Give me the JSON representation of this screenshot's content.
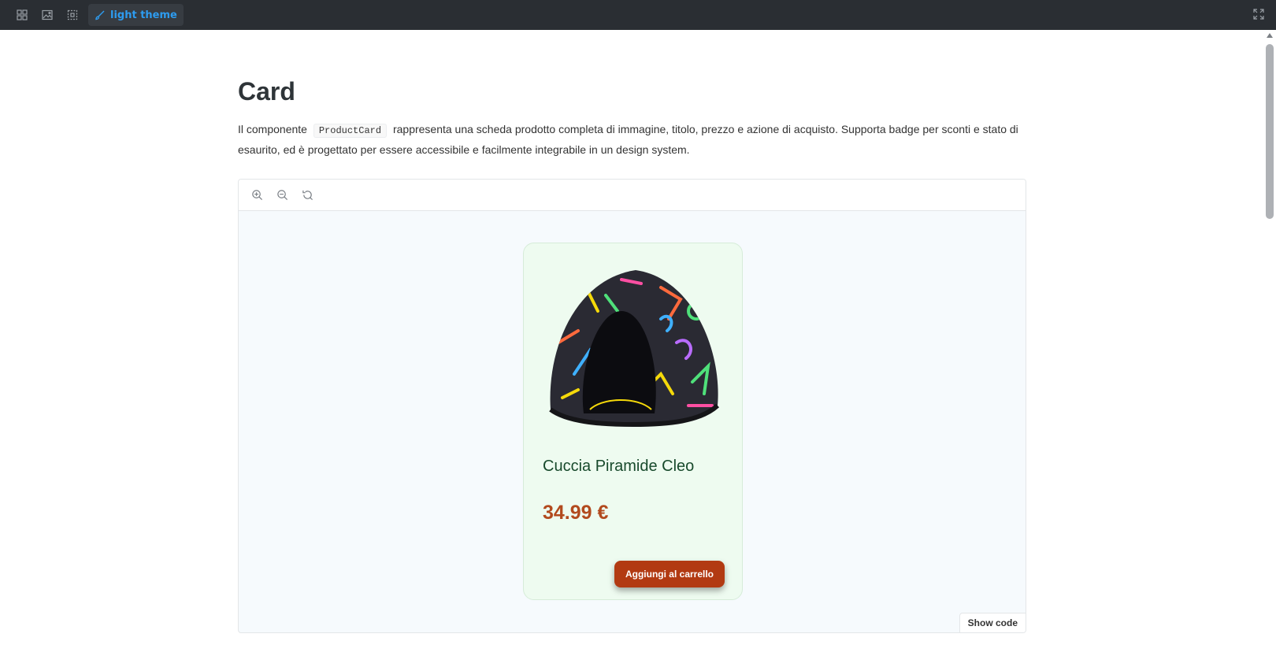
{
  "toolbar": {
    "icons": [
      "grid-icon",
      "image-icon",
      "frame-icon"
    ],
    "theme_label": "light theme",
    "theme_icon": "brush-icon",
    "fullscreen_icon": "fullscreen-icon"
  },
  "page": {
    "title": "Card",
    "intro_before": "Il componente",
    "intro_code": "ProductCard",
    "intro_after": "rappresenta una scheda prodotto completa di immagine, titolo, prezzo e azione di acquisto. Supporta badge per sconti e stato di esaurito, ed è progettato per essere accessibile e facilmente integrabile in un design system."
  },
  "canvas": {
    "zoom_icons": [
      "zoom-in-icon",
      "zoom-out-icon",
      "reset-zoom-icon"
    ],
    "show_code_label": "Show code"
  },
  "product": {
    "title": "Cuccia Piramide Cleo",
    "price": "34.99 €",
    "button_label": "Aggiungi al carrello",
    "image": "pyramid-pet-bed-image"
  },
  "colors": {
    "toolbar_bg": "#2a2e33",
    "theme_accent": "#2d9cf0",
    "card_bg": "#eefbf0",
    "title_color": "#184a2c",
    "price_color": "#b24a1e",
    "button_bg": "#b23a12"
  }
}
